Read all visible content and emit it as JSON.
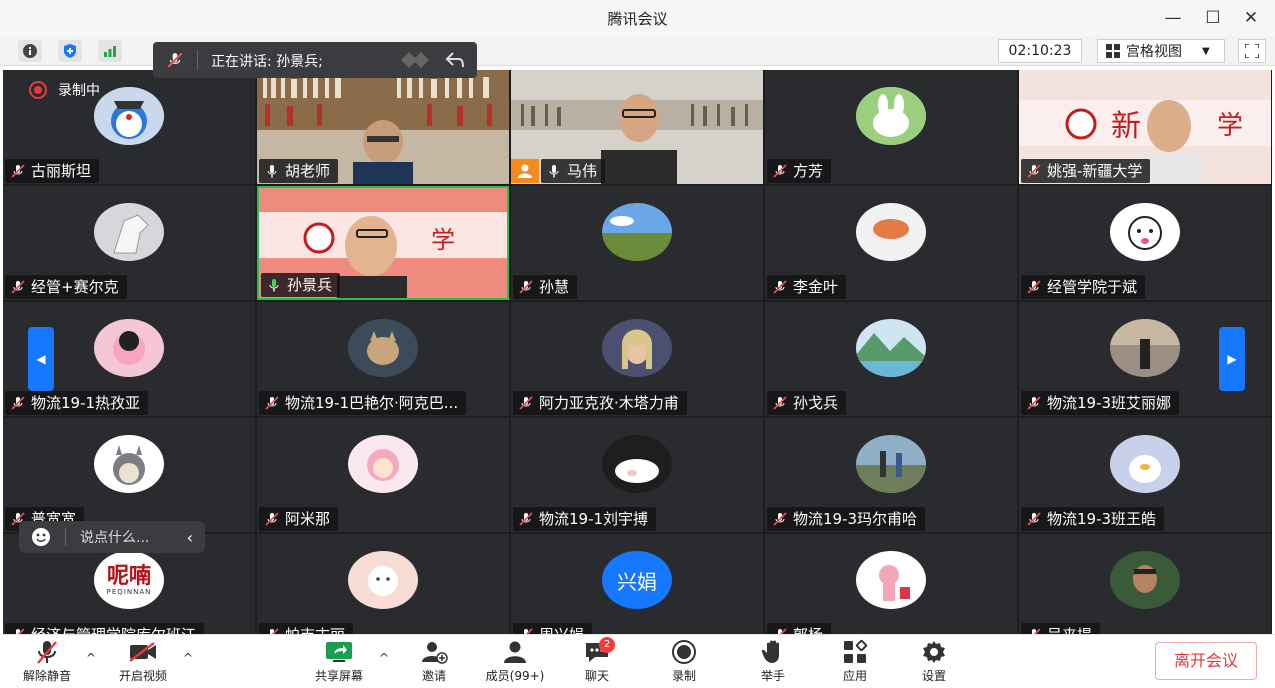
{
  "window": {
    "title": "腾讯会议"
  },
  "topbar": {
    "timer": "02:10:23",
    "view_mode": "宫格视图",
    "speaking_label": "正在讲话: 孙景兵;"
  },
  "recording": {
    "label": "录制中"
  },
  "chat": {
    "placeholder": "说点什么..."
  },
  "tiles": [
    {
      "name": "古丽斯坦",
      "kind": "avatar",
      "mic": "muted"
    },
    {
      "name": "胡老师",
      "kind": "video",
      "mic": "on"
    },
    {
      "name": "马伟",
      "kind": "video",
      "mic": "on",
      "host": true
    },
    {
      "name": "方芳",
      "kind": "avatar",
      "mic": "muted"
    },
    {
      "name": "姚强-新疆大学",
      "kind": "video",
      "mic": "muted"
    },
    {
      "name": "经管+赛尔克",
      "kind": "avatar",
      "mic": "muted"
    },
    {
      "name": "孙景兵",
      "kind": "video",
      "mic": "on"
    },
    {
      "name": "孙慧",
      "kind": "avatar",
      "mic": "muted"
    },
    {
      "name": "李金叶",
      "kind": "avatar",
      "mic": "muted"
    },
    {
      "name": "经管学院于斌",
      "kind": "avatar",
      "mic": "muted"
    },
    {
      "name": "物流19-1热孜亚",
      "kind": "avatar",
      "mic": "muted"
    },
    {
      "name": "物流19-1巴艳尔·阿克巴...",
      "kind": "avatar",
      "mic": "muted"
    },
    {
      "name": "阿力亚克孜·木塔力甫",
      "kind": "avatar",
      "mic": "muted"
    },
    {
      "name": "孙戈兵",
      "kind": "avatar",
      "mic": "muted"
    },
    {
      "name": "物流19-3班艾丽娜",
      "kind": "avatar",
      "mic": "muted"
    },
    {
      "name": "普宽宽",
      "kind": "avatar",
      "mic": "muted"
    },
    {
      "name": "阿米那",
      "kind": "avatar",
      "mic": "muted"
    },
    {
      "name": "物流19-1刘宇搏",
      "kind": "avatar",
      "mic": "muted"
    },
    {
      "name": "物流19-3玛尔甫哈",
      "kind": "avatar",
      "mic": "muted"
    },
    {
      "name": "物流19-3班王皓",
      "kind": "avatar",
      "mic": "muted"
    },
    {
      "name": "经济与管理学院库尔班江",
      "kind": "avatar",
      "mic": "muted",
      "avatar_text": "呢喃",
      "avatar_sub": "PEQINNAN"
    },
    {
      "name": "帕吉古丽",
      "kind": "avatar",
      "mic": "muted"
    },
    {
      "name": "周兴娟",
      "kind": "avatar",
      "mic": "muted",
      "avatar_text": "兴娟"
    },
    {
      "name": "郭杨",
      "kind": "avatar",
      "mic": "muted"
    },
    {
      "name": "吴来提",
      "kind": "avatar",
      "mic": "muted"
    }
  ],
  "toolbar": {
    "unmute": "解除静音",
    "start_video": "开启视频",
    "share_screen": "共享屏幕",
    "invite": "邀请",
    "members": "成员(99+)",
    "chat": "聊天",
    "chat_badge": "2",
    "record": "录制",
    "raise_hand": "举手",
    "apps": "应用",
    "settings": "设置",
    "leave": "离开会议"
  },
  "colors": {
    "accent": "#1677ff",
    "leave": "#e03a3a",
    "share_green": "#1a9e4f",
    "badge": "#f53b3b"
  }
}
